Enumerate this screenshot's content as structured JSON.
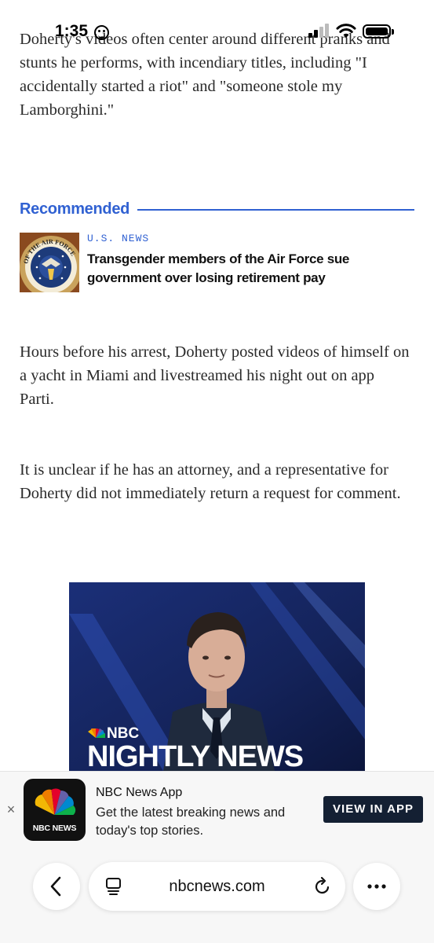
{
  "status_bar": {
    "time": "1:35"
  },
  "article": {
    "paragraph_1": "Doherty's videos often center around different pranks and stunts he performs, with incendiary titles, including \"I accidentally started a riot\" and \"someone stole my Lamborghini.\"",
    "paragraph_2": "Hours before his arrest, Doherty posted videos of himself on a yacht in Miami and livestreamed his night out on app Parti.",
    "paragraph_3": "It is unclear if he has an attorney, and a representative for Doherty did not immediately return a request for comment."
  },
  "recommended": {
    "label": "Recommended",
    "item": {
      "kicker": "U.S. NEWS",
      "headline": "Transgender members of the Air Force sue government over losing retirement pay",
      "thumb_seal_text": "OF THE AIR FORCE"
    }
  },
  "video": {
    "logo_text": "NBC",
    "title": "NIGHTLY NEWS"
  },
  "app_banner": {
    "close_symbol": "×",
    "icon_label": "NBC NEWS",
    "title": "NBC News App",
    "description": "Get the latest breaking news and today's top stories.",
    "cta": "VIEW IN APP"
  },
  "browser": {
    "url": "nbcnews.com"
  },
  "colors": {
    "accent_blue": "#3061d2",
    "cta_navy": "#142033",
    "video_bg": "#14235a"
  },
  "icons": {
    "back": "chevron-left-icon",
    "tabs": "tabs-icon",
    "reload": "reload-icon",
    "more": "more-dots-icon",
    "close": "close-icon"
  }
}
